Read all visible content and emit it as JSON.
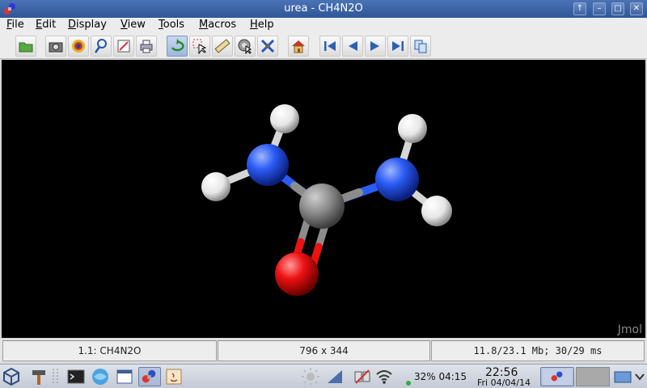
{
  "window": {
    "title": "urea - CH4N2O",
    "controls": [
      "up-icon",
      "minimize-icon",
      "maximize-icon",
      "close-icon"
    ]
  },
  "menubar": {
    "items": [
      {
        "label": "File",
        "mnemonic": "F"
      },
      {
        "label": "Edit",
        "mnemonic": "E"
      },
      {
        "label": "Display",
        "mnemonic": "D"
      },
      {
        "label": "View",
        "mnemonic": "V"
      },
      {
        "label": "Tools",
        "mnemonic": "T"
      },
      {
        "label": "Macros",
        "mnemonic": "M"
      },
      {
        "label": "Help",
        "mnemonic": "H"
      }
    ]
  },
  "toolbar": {
    "buttons": [
      "open-icon",
      "screenshot-icon",
      "pov-ray-icon",
      "pdb-search-icon",
      "script-editor-icon",
      "print-icon",
      "rotate-icon",
      "select-icon",
      "measure-icon",
      "pick-center-icon",
      "modelkit-icon",
      "home-icon",
      "first-frame-icon",
      "previous-frame-icon",
      "next-frame-icon",
      "last-frame-icon",
      "copy-icon"
    ],
    "active": "rotate-icon"
  },
  "viewer": {
    "watermark": "Jmol",
    "background": "#000000",
    "atoms": {
      "carbon": "#8c8c8c",
      "nitrogen": "#2a5cf5",
      "oxygen": "#ee1111",
      "hydrogen": "#f2f2f2"
    }
  },
  "status": {
    "model": "1.1: CH4N2O",
    "size": "796 x 344",
    "memory": "11.8/23.1 Mb;  30/29 ms"
  },
  "taskbar": {
    "battery": "32% 04:15",
    "time": "22:56",
    "date": "Fri 04/04/14"
  }
}
